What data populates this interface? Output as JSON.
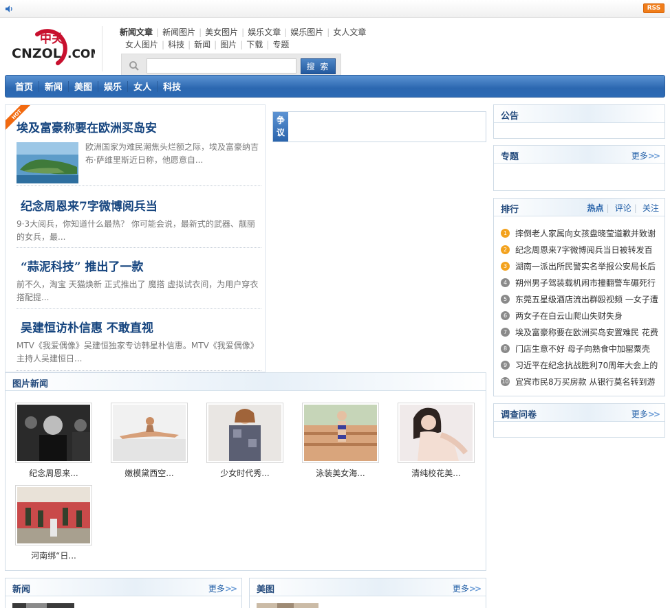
{
  "topbar": {
    "rss_label": "RSS"
  },
  "header": {
    "links_row1": [
      "新闻文章",
      "新闻图片",
      "美女图片",
      "娱乐文章",
      "娱乐图片",
      "女人文章"
    ],
    "links_row2": [
      "女人图片",
      "科技",
      "新闻",
      "图片",
      "下载",
      "专题"
    ],
    "search": {
      "value": "",
      "button": "搜 索"
    }
  },
  "nav": [
    "首页",
    "新闻",
    "美图",
    "娱乐",
    "女人",
    "科技"
  ],
  "headlines": [
    {
      "title": "埃及富豪称要在欧洲买岛安",
      "summary": "欧洲国家为难民潮焦头烂额之际，埃及富豪纳吉布·萨维里斯近日称，他愿意自..."
    },
    {
      "title": "纪念周恩来7字微博阅兵当",
      "summary": "9·3大阅兵，你知道什么最热？ 你可能会说，最新式的武器、靓丽的女兵，最..."
    },
    {
      "title": "“蒜泥科技” 推出了一款",
      "summary": "前不久，淘宝 天猫焕新 正式推出了 魔搭 虚拟试衣间，为用户穿衣搭配提..."
    },
    {
      "title": "吴建恒访朴信惠 不敢直视",
      "summary": "MTV《我爱偶像》吴建恒独家专访韩星朴信惠。MTV《我爱偶像》主持人吴建恒日..."
    }
  ],
  "dispute": {
    "label": "争议"
  },
  "right": {
    "notice_title": "公告",
    "topic_title": "专题",
    "more_label": "更多",
    "rank_title": "排行",
    "rank_tabs": [
      "热点",
      "评论",
      "关注"
    ],
    "rank_items": [
      "摔倒老人家属向女孩盘晓莹道歉并致谢",
      "纪念周恩来7字微博阅兵当日被转发百",
      "湖南一派出所民警实名举报公安局长后",
      "朔州男子驾装载机闹市撞翻警车碾死行",
      "东莞五星级酒店流出群殴视频 一女子遭",
      "两女子在白云山爬山失财失身",
      "埃及富豪称要在欧洲买岛安置难民 花费",
      "门店生意不好 母子向熟食中加罂粟壳",
      "习近平在纪念抗战胜利70周年大会上的",
      "宜宾市民8万买房款 从银行莫名转到游"
    ],
    "survey_title": "调查问卷"
  },
  "photo_news": {
    "title": "图片新闻",
    "items": [
      "纪念周恩来...",
      "嫩模黛西空...",
      "少女时代秀...",
      "泳装美女海...",
      "清纯校花美...",
      "河南绑“日..."
    ]
  },
  "bottom": {
    "news_title": "新闻",
    "beauty_title": "美图"
  }
}
